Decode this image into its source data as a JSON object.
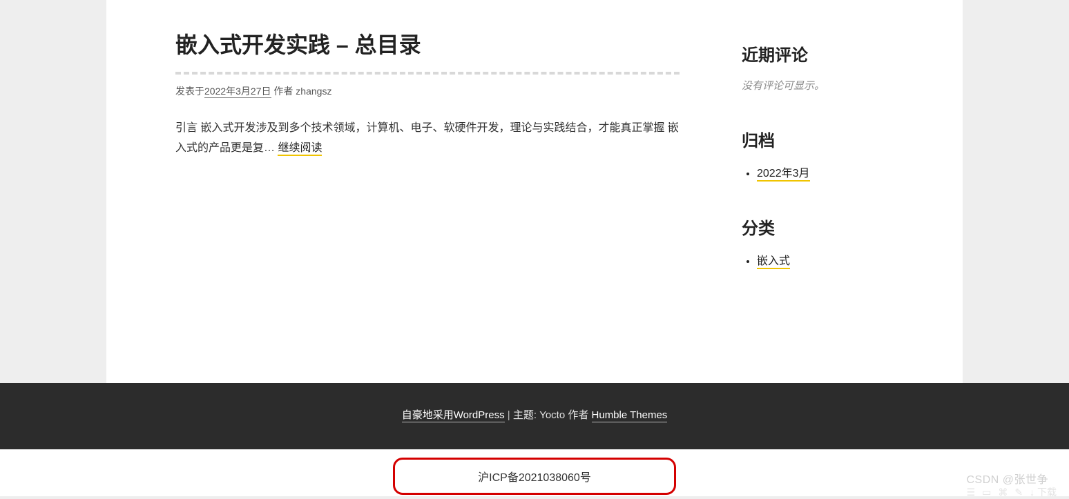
{
  "post": {
    "title": "嵌入式开发实践 – 总目录",
    "meta_prefix": "发表于",
    "date": "2022年3月27日",
    "author_prefix": "作者",
    "author": "zhangsz",
    "excerpt": "引言 嵌入式开发涉及到多个技术领域，计算机、电子、软硬件开发，理论与实践结合，才能真正掌握 嵌入式的产品更是复… ",
    "read_more": "继续阅读"
  },
  "sidebar": {
    "comments": {
      "title": "近期评论",
      "empty": "没有评论可显示。"
    },
    "archive": {
      "title": "归档",
      "items": [
        "2022年3月"
      ]
    },
    "categories": {
      "title": "分类",
      "items": [
        "嵌入式"
      ]
    }
  },
  "footer": {
    "wp_link": "自豪地采用WordPress",
    "sep": " | ",
    "theme_text": "主题: Yocto 作者 ",
    "theme_link": "Humble Themes"
  },
  "icp": "沪ICP备2021038060号",
  "watermark": "CSDN @张世争",
  "bottom_hint": "↓ 下载"
}
